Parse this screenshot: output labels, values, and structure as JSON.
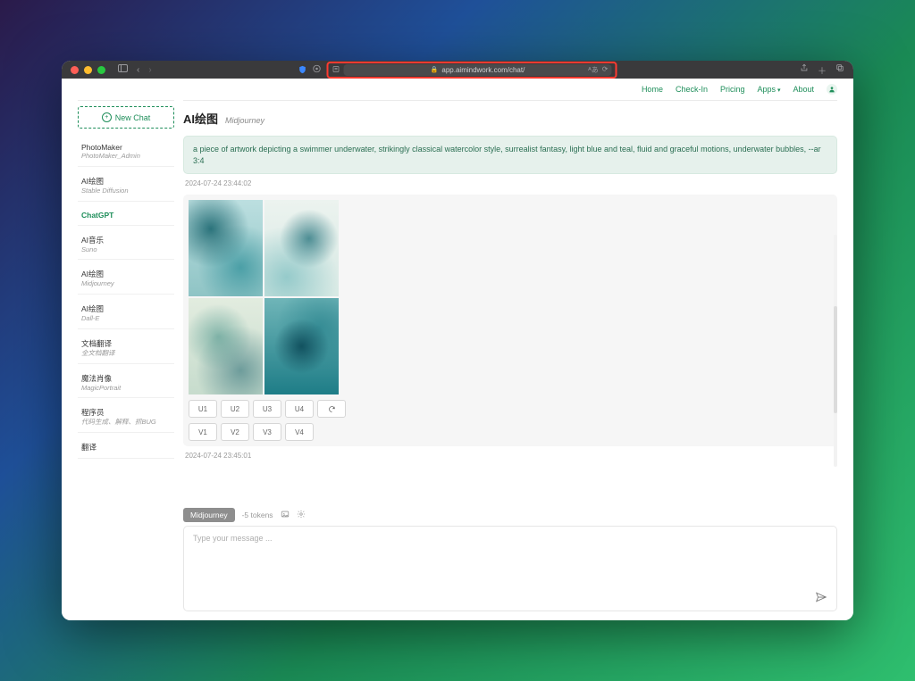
{
  "browser": {
    "url": "app.aimindwork.com/chat/"
  },
  "nav": {
    "home": "Home",
    "checkin": "Check-In",
    "pricing": "Pricing",
    "apps": "Apps",
    "about": "About"
  },
  "sidebar": {
    "new_chat": "New Chat",
    "items": [
      {
        "title": "PhotoMaker",
        "sub": "PhotoMaker_Admin",
        "active": false
      },
      {
        "title": "AI绘图",
        "sub": "Stable Diffusion",
        "active": false
      },
      {
        "title": "ChatGPT",
        "sub": "",
        "active": true
      },
      {
        "title": "AI音乐",
        "sub": "Suno",
        "active": false
      },
      {
        "title": "AI绘图",
        "sub": "Midjourney",
        "active": false
      },
      {
        "title": "AI绘图",
        "sub": "Dall-E",
        "active": false
      },
      {
        "title": "文档翻译",
        "sub": "全文档翻译",
        "active": false
      },
      {
        "title": "魔法肖像",
        "sub": "MagicPortrait",
        "active": false
      },
      {
        "title": "程序员",
        "sub": "代码生成、解释、抓BUG",
        "active": false
      },
      {
        "title": "翻译",
        "sub": "",
        "active": false
      }
    ]
  },
  "chat": {
    "header_title": "AI绘图",
    "header_sub": "Midjourney",
    "prompt": "a piece of artwork depicting a swimmer underwater, strikingly classical watercolor style, surrealist fantasy, light blue and teal, fluid and graceful motions, underwater bubbles, --ar 3:4",
    "prompt_time": "2024-07-24 23:44:02",
    "response_time": "2024-07-24 23:45:01",
    "buttons_u": [
      "U1",
      "U2",
      "U3",
      "U4"
    ],
    "refresh": "↻",
    "buttons_v": [
      "V1",
      "V2",
      "V3",
      "V4"
    ]
  },
  "composer": {
    "tag": "Midjourney",
    "tokens": "-5 tokens",
    "placeholder": "Type your message ..."
  }
}
